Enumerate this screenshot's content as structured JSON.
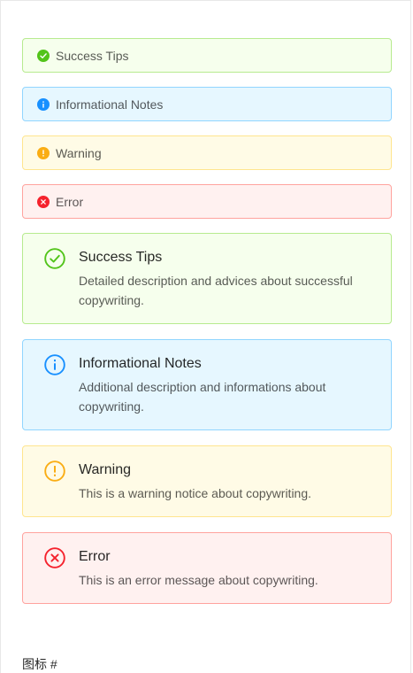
{
  "colors": {
    "success": "#52c41a",
    "info": "#1890ff",
    "warning": "#faad14",
    "error": "#f5222d"
  },
  "alerts_compact": [
    {
      "type": "success",
      "icon": "check-circle-icon",
      "message": "Success Tips"
    },
    {
      "type": "info",
      "icon": "info-circle-icon",
      "message": "Informational Notes"
    },
    {
      "type": "warning",
      "icon": "exclamation-circle-icon",
      "message": "Warning"
    },
    {
      "type": "error",
      "icon": "close-circle-icon",
      "message": "Error"
    }
  ],
  "alerts_with_description": [
    {
      "type": "success",
      "icon": "check-circle-outline-icon",
      "message": "Success Tips",
      "description": "Detailed description and advices about successful copywriting."
    },
    {
      "type": "info",
      "icon": "info-circle-outline-icon",
      "message": "Informational Notes",
      "description": "Additional description and informations about copywriting."
    },
    {
      "type": "warning",
      "icon": "exclamation-circle-outline-icon",
      "message": "Warning",
      "description": "This is a warning notice about copywriting."
    },
    {
      "type": "error",
      "icon": "close-circle-outline-icon",
      "message": "Error",
      "description": "This is an error message about copywriting."
    }
  ],
  "footer": {
    "section_title": "图标 #"
  }
}
